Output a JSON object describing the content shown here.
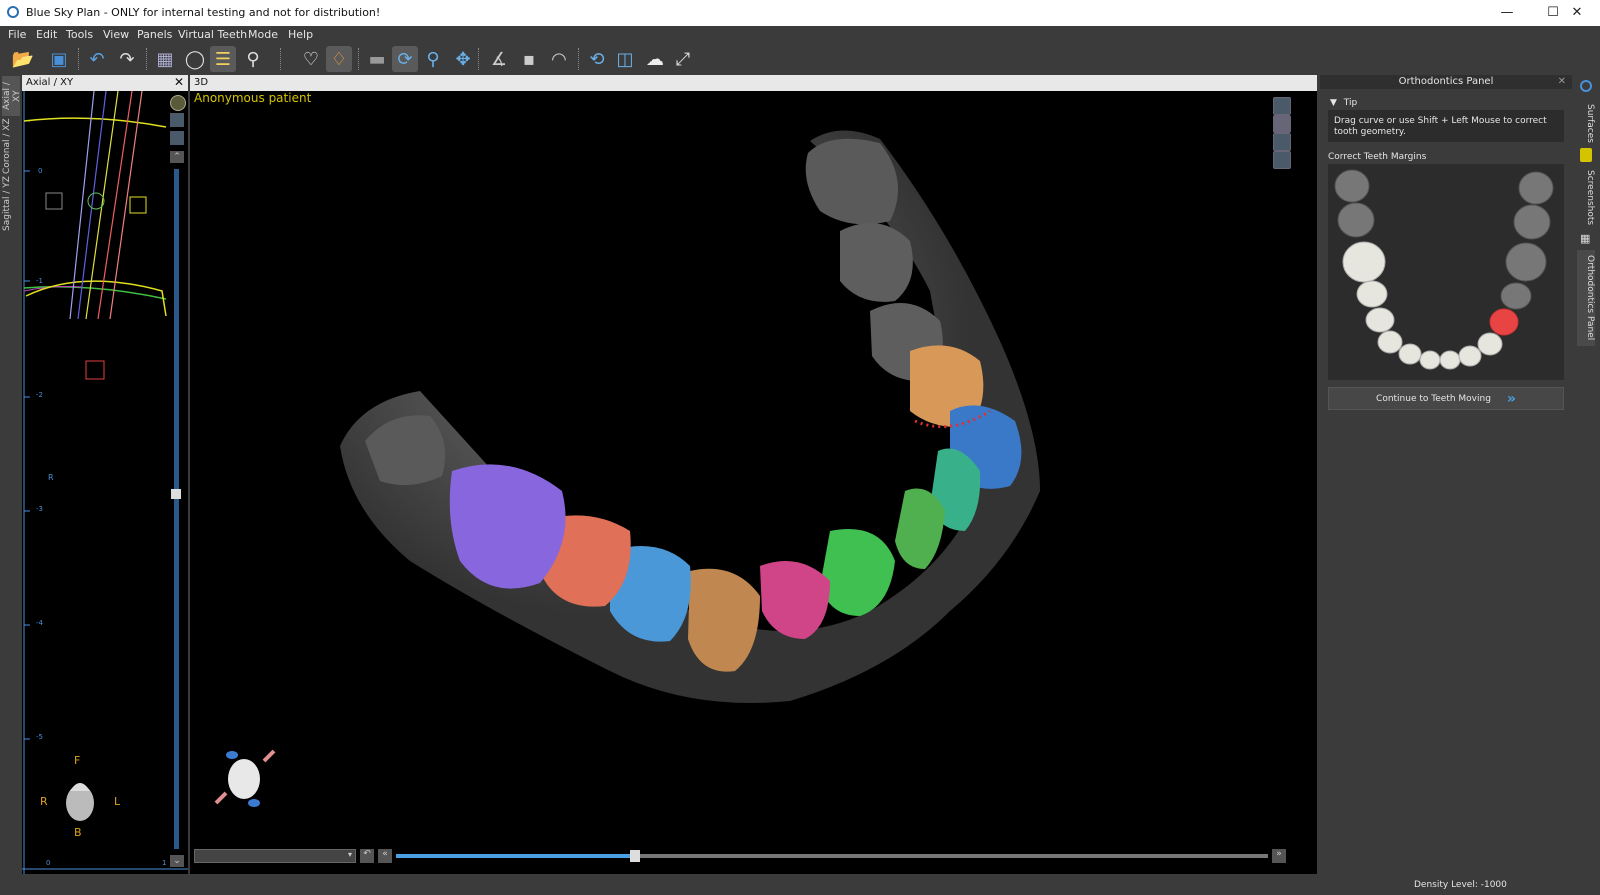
{
  "window": {
    "title": "Blue Sky Plan - ONLY for internal testing and not for distribution!"
  },
  "menu": [
    "File",
    "Edit",
    "Tools",
    "View",
    "Panels",
    "Virtual Teeth",
    "Mode",
    "Help"
  ],
  "left_tabs": [
    "Axial / XY",
    "Coronal / XZ",
    "Sagittal / YZ"
  ],
  "axial": {
    "header": "Axial / XY",
    "labels": {
      "front": "F",
      "right": "R",
      "left": "L",
      "back": "B",
      "r_mark": "R"
    },
    "ticks": [
      "0",
      "-1",
      "-2",
      "-3",
      "-4",
      "-5",
      "0",
      "1"
    ]
  },
  "view3d": {
    "header": "3D",
    "patient": "Anonymous patient"
  },
  "ortho": {
    "header": "Orthodontics Panel",
    "tip_label": "Tip",
    "tip_text": "Drag curve or use Shift + Left Mouse to correct tooth geometry.",
    "section_label": "Correct Teeth Margins",
    "continue_label": "Continue to Teeth Moving"
  },
  "right_tabs": [
    "Surfaces",
    "Screenshots",
    "Orthodontics Panel"
  ],
  "status": {
    "density": "Density Level: -1000"
  },
  "colors": {
    "accent": "#4aa0e0",
    "highlight_tooth": "#e84444",
    "patient_text": "#d4c400"
  }
}
